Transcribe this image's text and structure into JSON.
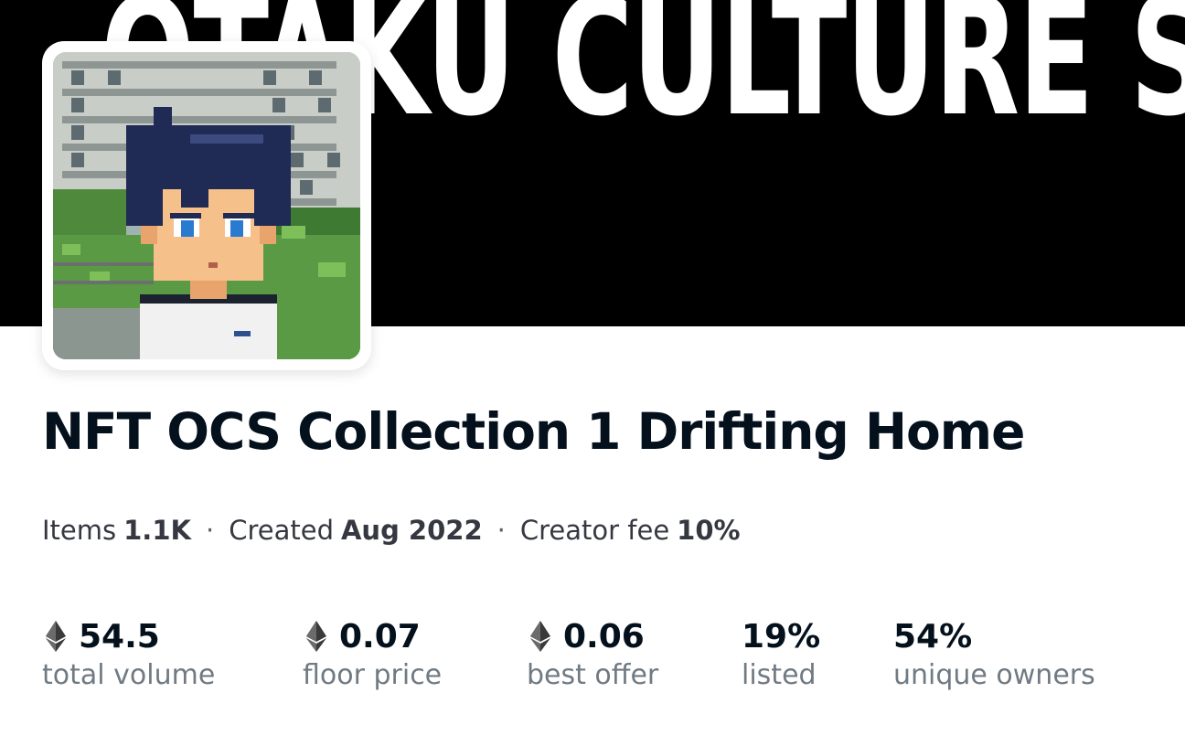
{
  "banner": {
    "text": "OTAKU CULTURE S"
  },
  "collection": {
    "title": "NFT OCS Collection 1 Drifting Home",
    "meta": [
      {
        "label": "Items",
        "value": "1.1K"
      },
      {
        "label": "Created",
        "value": "Aug 2022"
      },
      {
        "label": "Creator fee",
        "value": "10%"
      }
    ],
    "separator": "·"
  },
  "stats": [
    {
      "value": "54.5",
      "label": "total volume",
      "icon": "ethereum-icon"
    },
    {
      "value": "0.07",
      "label": "floor price",
      "icon": "ethereum-icon"
    },
    {
      "value": "0.06",
      "label": "best offer",
      "icon": "ethereum-icon"
    },
    {
      "value": "19%",
      "label": "listed"
    },
    {
      "value": "54%",
      "label": "unique owners"
    }
  ]
}
